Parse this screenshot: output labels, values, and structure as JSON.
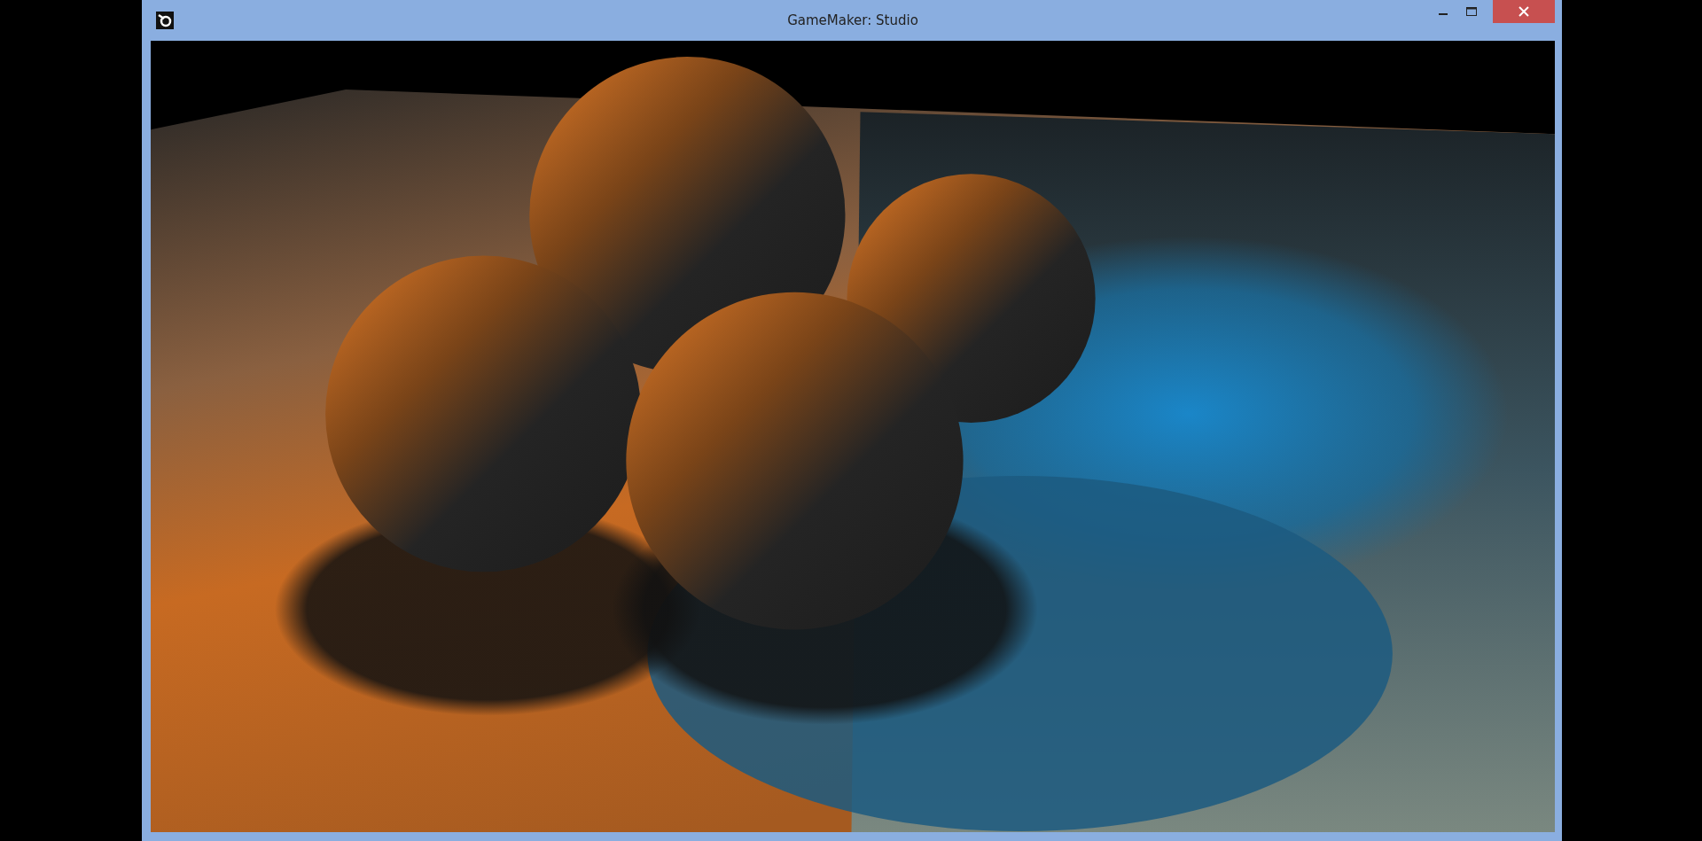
{
  "window": {
    "title": "GameMaker: Studio"
  }
}
